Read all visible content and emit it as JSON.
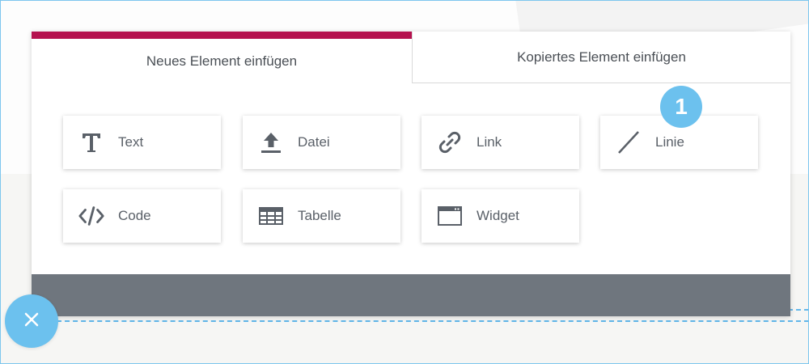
{
  "tabs": [
    {
      "label": "Neues Element einfügen",
      "active": true
    },
    {
      "label": "Kopiertes Element einfügen",
      "active": false
    }
  ],
  "elements": [
    {
      "label": "Text",
      "icon": "text-icon"
    },
    {
      "label": "Datei",
      "icon": "upload-icon"
    },
    {
      "label": "Link",
      "icon": "link-icon"
    },
    {
      "label": "Linie",
      "icon": "line-icon"
    },
    {
      "label": "Code",
      "icon": "code-icon"
    },
    {
      "label": "Tabelle",
      "icon": "table-icon"
    },
    {
      "label": "Widget",
      "icon": "widget-icon"
    }
  ],
  "badge": {
    "number": "1"
  },
  "colors": {
    "accent": "#b5124f",
    "badge": "#6cc1ee",
    "footer": "#6f767e",
    "icon": "#5a6068"
  },
  "close_button": {
    "icon": "close-icon"
  }
}
